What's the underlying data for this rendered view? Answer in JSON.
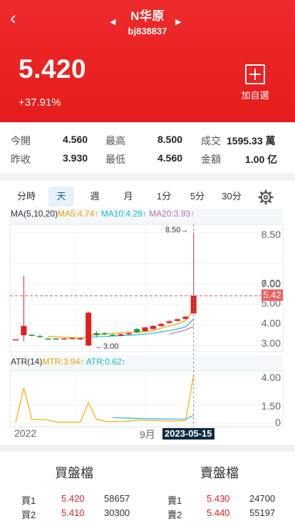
{
  "header": {
    "stock_name": "N华原",
    "stock_code": "bj838837",
    "price": "5.420",
    "change": "+37.91%",
    "watch_label": "加自選",
    "prev_icon": "◀",
    "next_icon": "▶",
    "back_icon": "‹"
  },
  "quote": {
    "row1": [
      {
        "label": "今開",
        "value": "4.560"
      },
      {
        "label": "最高",
        "value": "8.500"
      },
      {
        "label": "成交",
        "value": "1595.33 萬"
      }
    ],
    "row2": [
      {
        "label": "昨收",
        "value": "3.930"
      },
      {
        "label": "最低",
        "value": "4.560"
      },
      {
        "label": "金額",
        "value": "1.00 亿"
      }
    ]
  },
  "tabs": [
    "分時",
    "天",
    "週",
    "月",
    "1分",
    "5分",
    "30分"
  ],
  "active_tab": "天",
  "chart": {
    "ma_legend": {
      "label": "MA(5,10,20)",
      "ma5": "MA5:4.74↑",
      "ma10": "MA10:4.29↑",
      "ma20": "MA20:3.93↑"
    },
    "atr_legend": {
      "label": "ATR(14)",
      "mtr": "MTR:3.94↑",
      "atr": "ATR:0.62↑"
    },
    "y_ticks_price": [
      "8.50",
      "7.00",
      "6.00",
      "5.00",
      "4.00",
      "3.00"
    ],
    "y_ticks_atr": [
      "4.00",
      "1.50",
      "0"
    ],
    "x_labels": [
      "2022",
      "9月"
    ],
    "crosshair_date": "2023-05-15",
    "crosshair_price": "5.42",
    "high_annotation": "8.50→",
    "low_annotation": "←3.00",
    "colors": {
      "up": "#e02020",
      "down": "#1a9a3a",
      "ma5": "#f0a000",
      "ma10": "#19b8d6",
      "ma20": "#c76bb0",
      "atr": "#f0b000"
    }
  },
  "order_book": {
    "buy_title": "買盤檔",
    "sell_title": "賣盤檔",
    "buy": [
      {
        "label": "買1",
        "price": "5.420",
        "volume": "58657"
      },
      {
        "label": "買2",
        "price": "5.410",
        "volume": "30300"
      }
    ],
    "sell": [
      {
        "label": "賣1",
        "price": "5.430",
        "volume": "24700"
      },
      {
        "label": "賣2",
        "price": "5.440",
        "volume": "55197"
      }
    ]
  },
  "chart_data": {
    "type": "candlestick",
    "price_ylim": [
      2.7,
      8.9
    ],
    "candles": [
      {
        "o": 3.3,
        "h": 3.3,
        "l": 3.3,
        "c": 3.3
      },
      {
        "o": 3.5,
        "h": 6.4,
        "l": 3.2,
        "c": 3.95
      },
      {
        "o": 3.52,
        "h": 3.55,
        "l": 3.45,
        "c": 3.48
      },
      {
        "o": 3.46,
        "h": 3.52,
        "l": 3.4,
        "c": 3.42
      },
      {
        "o": 3.34,
        "h": 3.36,
        "l": 3.3,
        "c": 3.32
      },
      {
        "o": 3.34,
        "h": 3.36,
        "l": 3.3,
        "c": 3.33
      },
      {
        "o": 3.33,
        "h": 3.36,
        "l": 3.3,
        "c": 3.34
      },
      {
        "o": 3.35,
        "h": 3.38,
        "l": 3.32,
        "c": 3.36
      },
      {
        "o": 3.32,
        "h": 3.38,
        "l": 3.28,
        "c": 3.35
      },
      {
        "o": 3.0,
        "h": 4.65,
        "l": 2.95,
        "c": 4.6
      },
      {
        "o": 3.6,
        "h": 3.7,
        "l": 3.4,
        "c": 3.5
      },
      {
        "o": 3.6,
        "h": 3.65,
        "l": 3.5,
        "c": 3.55
      },
      {
        "o": 3.52,
        "h": 3.58,
        "l": 3.45,
        "c": 3.5
      },
      {
        "o": 3.48,
        "h": 3.58,
        "l": 3.45,
        "c": 3.55
      },
      {
        "o": 3.55,
        "h": 3.65,
        "l": 3.5,
        "c": 3.6
      },
      {
        "o": 3.8,
        "h": 3.85,
        "l": 3.6,
        "c": 3.65
      },
      {
        "o": 3.7,
        "h": 3.9,
        "l": 3.68,
        "c": 3.88
      },
      {
        "o": 3.8,
        "h": 4.0,
        "l": 3.78,
        "c": 3.95
      },
      {
        "o": 3.95,
        "h": 4.1,
        "l": 3.92,
        "c": 4.05
      },
      {
        "o": 4.1,
        "h": 4.22,
        "l": 4.05,
        "c": 4.18
      },
      {
        "o": 4.2,
        "h": 4.32,
        "l": 4.15,
        "c": 4.28
      },
      {
        "o": 4.3,
        "h": 4.45,
        "l": 4.25,
        "c": 4.4
      },
      {
        "o": 4.56,
        "h": 8.5,
        "l": 4.56,
        "c": 5.42
      }
    ],
    "ma5": [
      null,
      null,
      null,
      null,
      3.45,
      3.42,
      3.4,
      3.38,
      3.36,
      3.45,
      3.55,
      3.55,
      3.58,
      3.62,
      3.65,
      3.64,
      3.68,
      3.72,
      3.85,
      3.95,
      4.05,
      4.2,
      4.74
    ],
    "ma10": [
      null,
      null,
      null,
      null,
      null,
      null,
      null,
      null,
      null,
      3.4,
      3.42,
      3.44,
      3.46,
      3.48,
      3.5,
      3.52,
      3.56,
      3.6,
      3.66,
      3.72,
      3.8,
      3.9,
      4.29
    ],
    "ma20": [
      null,
      null,
      null,
      null,
      null,
      null,
      null,
      null,
      null,
      null,
      null,
      null,
      null,
      null,
      null,
      null,
      null,
      null,
      null,
      3.55,
      3.65,
      3.75,
      3.93
    ],
    "atr_ylim": [
      -0.3,
      4.3
    ],
    "mtr": [
      0.05,
      2.9,
      0.3,
      0.3,
      0.25,
      0.08,
      0.06,
      0.06,
      0.08,
      1.7,
      0.3,
      0.15,
      0.12,
      0.13,
      0.15,
      0.25,
      0.22,
      0.22,
      0.18,
      0.17,
      0.17,
      0.2,
      3.94
    ],
    "atr": [
      null,
      null,
      null,
      null,
      null,
      null,
      null,
      null,
      null,
      null,
      null,
      null,
      0.45,
      0.42,
      0.4,
      0.38,
      0.36,
      0.35,
      0.34,
      0.33,
      0.33,
      0.33,
      0.62
    ]
  }
}
